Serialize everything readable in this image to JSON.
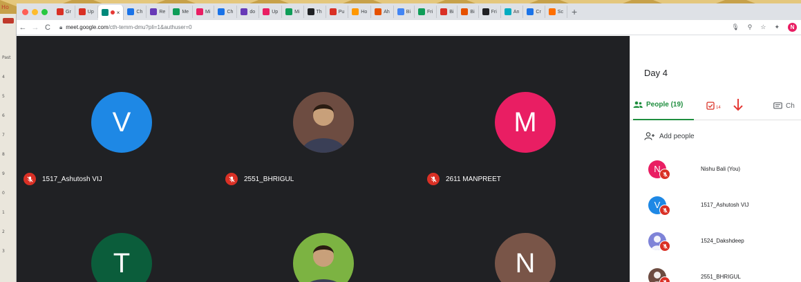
{
  "browser": {
    "tabs": [
      {
        "icon": "gmail-icon",
        "label": "Gr",
        "color": "#d93025"
      },
      {
        "icon": "gmail-icon",
        "label": "Up",
        "color": "#d93025"
      },
      {
        "icon": "meet-icon",
        "label": "",
        "color": "#00897b",
        "active": true
      },
      {
        "icon": "calendar-icon",
        "label": "Ch",
        "color": "#1a73e8"
      },
      {
        "icon": "form-icon",
        "label": "Re",
        "color": "#673ab7"
      },
      {
        "icon": "meet-icon",
        "label": "Me",
        "color": "#0f9d58"
      },
      {
        "icon": "play-icon",
        "label": "Mi",
        "color": "#e91e63"
      },
      {
        "icon": "calendar-icon",
        "label": "Ch",
        "color": "#1a73e8"
      },
      {
        "icon": "form-icon",
        "label": "do",
        "color": "#673ab7"
      },
      {
        "icon": "play-icon",
        "label": "Up",
        "color": "#e91e63"
      },
      {
        "icon": "grid-icon",
        "label": "Mi",
        "color": "#0f9d58"
      },
      {
        "icon": "globe-icon",
        "label": "Th",
        "color": "#202124"
      },
      {
        "icon": "flag-icon",
        "label": "Pu",
        "color": "#d93025"
      },
      {
        "icon": "ring-icon",
        "label": "Ho",
        "color": "#ff9800"
      },
      {
        "icon": "pencil-icon",
        "label": "Ah",
        "color": "#e65100"
      },
      {
        "icon": "google-icon",
        "label": "Bi",
        "color": "#4285f4"
      },
      {
        "icon": "leaf-icon",
        "label": "Fri",
        "color": "#0f9d58"
      },
      {
        "icon": "opera-icon",
        "label": "Bi",
        "color": "#d93025"
      },
      {
        "icon": "e-icon",
        "label": "Bi",
        "color": "#e65100"
      },
      {
        "icon": "globe-icon",
        "label": "Fri",
        "color": "#202124"
      },
      {
        "icon": "swirl-icon",
        "label": "An",
        "color": "#00acc1"
      },
      {
        "icon": "calendar-icon",
        "label": "Cr",
        "color": "#1a73e8"
      },
      {
        "icon": "stack-icon",
        "label": "Sc",
        "color": "#ff6f00"
      }
    ],
    "new_tab": "+",
    "url_host": "meet.google.com",
    "url_path": "/cth-temm-dmu?pli=1&authuser=0",
    "profile_initial": "N"
  },
  "meeting": {
    "participants": [
      {
        "name": "1517_Ashutosh VIJ",
        "initial": "V",
        "color": "#1e88e5",
        "photo": false
      },
      {
        "name": "2551_BHRIGUL",
        "initial": "",
        "color": "#6d4c41",
        "photo": true
      },
      {
        "name": "2611 MANPREET",
        "initial": "M",
        "color": "#e91e63",
        "photo": false
      },
      {
        "name": "",
        "initial": "T",
        "color": "#0b5d3b",
        "photo": false
      },
      {
        "name": "",
        "initial": "",
        "color": "#7cb342",
        "photo": true
      },
      {
        "name": "",
        "initial": "N",
        "color": "#795548",
        "photo": false
      }
    ]
  },
  "panel": {
    "title": "Day 4",
    "people_tab": "People (19)",
    "tasks_count": "14",
    "chat_tab": "Ch",
    "add_people": "Add people",
    "people": [
      {
        "name": "Nishu Bali (You)",
        "initial": "N",
        "color": "#e91e63"
      },
      {
        "name": "1517_Ashutosh VIJ",
        "initial": "V",
        "color": "#1e88e5"
      },
      {
        "name": "1524_Dakshdeep",
        "initial": "",
        "color": "#7e83d8"
      },
      {
        "name": "2551_BHRIGUL",
        "initial": "",
        "color": "#6d4c41"
      }
    ]
  },
  "colors": {
    "accent_green": "#1e8e3e",
    "mic_red": "#d93025",
    "meet_bg": "#202124",
    "gold": "#c7a14a"
  },
  "left_app": {
    "tab": "Ho",
    "rows": [
      "Past",
      "4",
      "5",
      "6",
      "7",
      "8",
      "9",
      "0",
      "1",
      "2",
      "3"
    ]
  }
}
